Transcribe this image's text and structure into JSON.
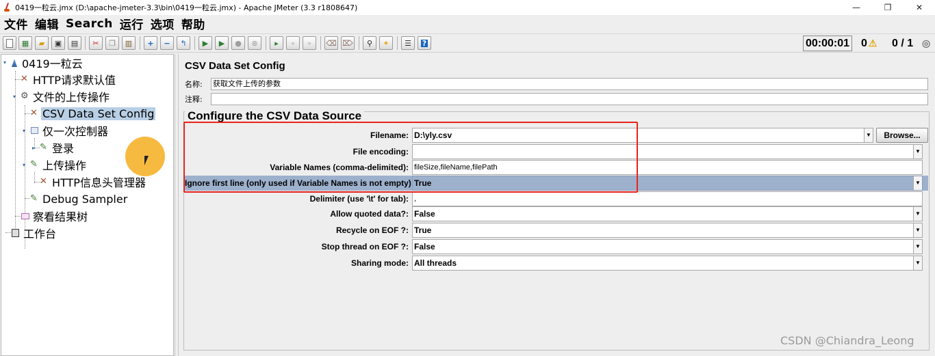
{
  "window": {
    "title": "0419一粒云.jmx (D:\\apache-jmeter-3.3\\bin\\0419一粒云.jmx) - Apache JMeter (3.3 r1808647)",
    "minimize_glyph": "—",
    "maximize_glyph": "❐",
    "close_glyph": "✕"
  },
  "menu": [
    "文件",
    "编辑",
    "Search",
    "运行",
    "选项",
    "帮助"
  ],
  "toolbar": {
    "timer": "00:00:01",
    "warnings": "0",
    "threads": "0 / 1",
    "icons": [
      "new-icon",
      "template-icon",
      "open-icon",
      "save-icon",
      "save-as-icon",
      "cut-icon",
      "copy-icon",
      "paste-icon",
      "expand-icon",
      "collapse-icon",
      "toggle-icon",
      "start-icon",
      "start-no-pause-icon",
      "stop-icon",
      "shutdown-icon",
      "remote-start-icon",
      "remote-stop-icon",
      "remote-shutdown-icon",
      "clear-icon",
      "clear-all-icon",
      "search-icon",
      "reset-search-icon",
      "function-helper-icon",
      "help-icon"
    ]
  },
  "tree": [
    {
      "label": "0419一粒云",
      "icon": "test-plan-icon"
    },
    {
      "label": "HTTP请求默认值",
      "icon": "config-icon"
    },
    {
      "label": "文件的上传操作",
      "icon": "thread-group-icon"
    },
    {
      "label": "CSV Data Set Config",
      "icon": "config-icon",
      "selected": true
    },
    {
      "label": "仅一次控制器",
      "icon": "controller-icon"
    },
    {
      "label": "登录",
      "icon": "sampler-icon"
    },
    {
      "label": "上传操作",
      "icon": "sampler-icon"
    },
    {
      "label": "HTTP信息头管理器",
      "icon": "config-icon"
    },
    {
      "label": "Debug Sampler",
      "icon": "sampler-icon"
    },
    {
      "label": "察看结果树",
      "icon": "listener-icon"
    },
    {
      "label": "工作台",
      "icon": "workbench-icon"
    }
  ],
  "panel": {
    "title": "CSV Data Set Config",
    "name_label": "名称:",
    "name_value": "获取文件上传的参数",
    "comment_label": "注释:",
    "comment_value": "",
    "group_title": "Configure the CSV Data Source",
    "browse_label": "Browse...",
    "rows": [
      {
        "label": "Filename:",
        "value": "D:\\yly.csv",
        "combo": true
      },
      {
        "label": "File encoding:",
        "value": "",
        "combo": true
      },
      {
        "label": "Variable Names (comma-delimited):",
        "value": "fileSize,fileName,filePath",
        "combo": false
      },
      {
        "label": "Ignore first line (only used if Variable Names is not empty):",
        "value": "True",
        "combo": true
      },
      {
        "label": "Delimiter (use '\\t' for tab):",
        "value": ",",
        "combo": false
      },
      {
        "label": "Allow quoted data?:",
        "value": "False",
        "combo": true
      },
      {
        "label": "Recycle on EOF ?:",
        "value": "True",
        "combo": true
      },
      {
        "label": "Stop thread on EOF ?:",
        "value": "False",
        "combo": true
      },
      {
        "label": "Sharing mode:",
        "value": "All threads",
        "combo": true
      }
    ]
  },
  "watermark": "CSDN @Chiandra_Leong",
  "colors": {
    "selection": "#b8cfe5",
    "highlight_row": "#9db1cd",
    "annotation_box": "#e8231b",
    "cursor_dot": "#f6b126"
  }
}
